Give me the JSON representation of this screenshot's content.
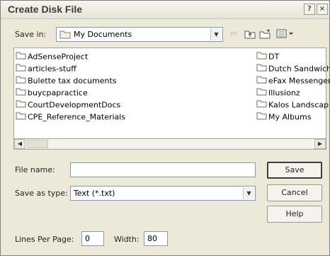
{
  "window": {
    "title": "Create Disk File"
  },
  "titlebar_buttons": {
    "help": "?",
    "close": "×"
  },
  "save_in": {
    "label": "Save in:",
    "value": "My Documents"
  },
  "files_left": [
    "AdSenseProject",
    "articles-stuff",
    "Bulette tax documents",
    "buycpapractice",
    "CourtDevelopmentDocs",
    "CPE_Reference_Materials"
  ],
  "files_right": [
    "DT",
    "Dutch Sandwich",
    "eFax Messenger",
    "Illusionz",
    "Kalos Landscapin",
    "My Albums"
  ],
  "file_name": {
    "label": "File name:",
    "value": ""
  },
  "save_as_type": {
    "label": "Save as type:",
    "value": "Text (*.txt)"
  },
  "buttons": {
    "save": "Save",
    "cancel": "Cancel",
    "help": "Help"
  },
  "lines_per_page": {
    "label": "Lines Per Page:",
    "value": "0"
  },
  "width": {
    "label": "Width:",
    "value": "80"
  },
  "icons": {
    "up_folder": "up-folder-icon",
    "new_folder": "new-folder-icon",
    "views": "views-menu-icon",
    "back": "back-arrow-icon"
  }
}
